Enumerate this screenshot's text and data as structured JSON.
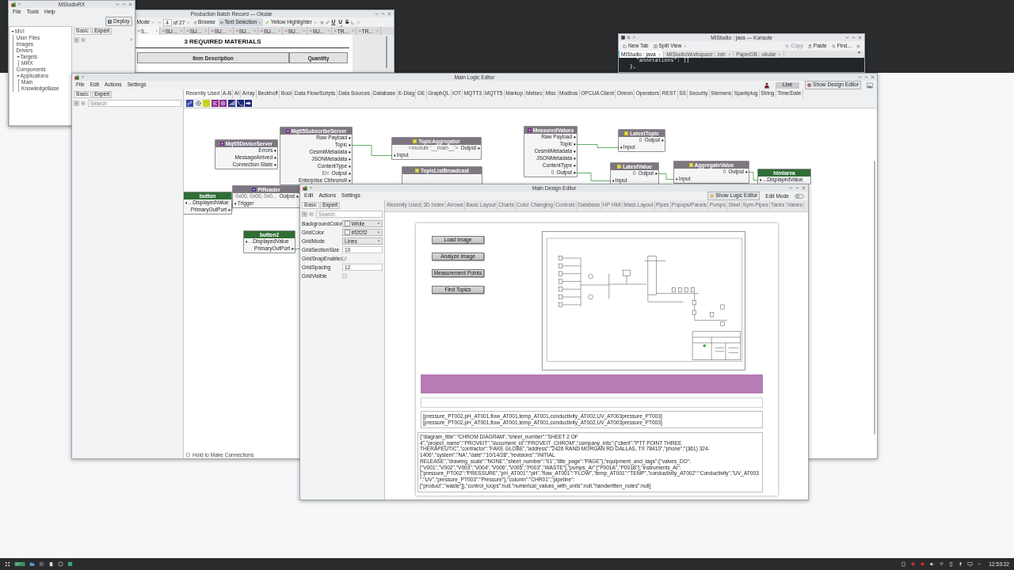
{
  "studio_window": {
    "title": "MStudioRX",
    "menu": [
      "File",
      "Tools",
      "Help"
    ],
    "deploy_button": "Deploy",
    "tree": [
      {
        "label": "MVI",
        "expanded": true,
        "children": [
          {
            "label": "User Files"
          },
          {
            "label": "Images"
          },
          {
            "label": "Drivers"
          },
          {
            "label": "Targets",
            "expanded": true,
            "children": [
              {
                "label": "MRX"
              }
            ]
          },
          {
            "label": "Components"
          },
          {
            "label": "Applications",
            "expanded": true,
            "children": [
              {
                "label": "Main"
              },
              {
                "label": "KnowledgeBase"
              }
            ]
          }
        ]
      }
    ],
    "panel_tabs": [
      {
        "label": "Basic",
        "selected": true
      },
      {
        "label": "Expert",
        "selected": false
      }
    ]
  },
  "pdf_window": {
    "title": "Production Batch Record — Okular",
    "mode_select": "Mode",
    "page_field": "4",
    "page_count": "of 27",
    "tools": [
      {
        "label": "Browse",
        "selected": false
      },
      {
        "label": "Text Selection",
        "selected": true
      }
    ],
    "highlighter_select": "Yellow Highlighter",
    "format_buttons": [
      {
        "label": "U",
        "kind": "underline"
      },
      {
        "label": "U",
        "kind": "squiggle"
      },
      {
        "label": "S",
        "kind": "strike"
      }
    ],
    "doc_tabs": [
      {
        "label": "S...",
        "selected": true
      },
      {
        "label": "SU...",
        "selected": false
      },
      {
        "label": "SU...",
        "selected": false
      },
      {
        "label": "SU...",
        "selected": false
      },
      {
        "label": "SU...",
        "selected": false
      },
      {
        "label": "SU...",
        "selected": false
      },
      {
        "label": "SU...",
        "selected": false
      },
      {
        "label": "SU...",
        "selected": false
      },
      {
        "label": "TR...",
        "selected": false
      },
      {
        "label": "TR...",
        "selected": false
      }
    ],
    "heading": "3 REQUIRED MATERIALS",
    "table_columns": [
      "Item Description",
      "Quantity"
    ]
  },
  "console_window": {
    "title": "MIStudio : java — Konsole",
    "toolbar_left": [
      {
        "label": "New Tab",
        "kind": "new-tab"
      },
      {
        "label": "Split View",
        "kind": "split"
      }
    ],
    "toolbar_right": [
      {
        "label": "Copy",
        "kind": "copy",
        "disabled": true
      },
      {
        "label": "Paste",
        "kind": "paste",
        "disabled": false
      },
      {
        "label": "Find...",
        "kind": "find",
        "disabled": false
      }
    ],
    "tabs": [
      {
        "label": "MIStudio : java",
        "selected": true
      },
      {
        "label": "MIStudioWorkspace : zsh",
        "selected": false
      },
      {
        "label": "PaperDB : okular",
        "selected": false
      }
    ],
    "lines": [
      "    \"annotations\": []",
      "  },"
    ]
  },
  "logic_window": {
    "title": "Main Logic Editor",
    "menu": [
      "File",
      "Edit",
      "Actions",
      "Settings"
    ],
    "live_button": "Live",
    "design_button": "Show Design Editor",
    "panel_tabs": [
      {
        "label": "Basic",
        "selected": true
      },
      {
        "label": "Expert",
        "selected": false
      }
    ],
    "search_placeholder": "Search",
    "palette_tabs": [
      {
        "label": "Recently Used",
        "selected": true
      },
      {
        "label": "A-B",
        "selected": false
      },
      {
        "label": "AI",
        "selected": false
      },
      {
        "label": "Array",
        "selected": false
      },
      {
        "label": "Beckhoff",
        "selected": false
      },
      {
        "label": "Bool",
        "selected": false
      },
      {
        "label": "Data Flow/Scripts",
        "selected": false
      },
      {
        "label": "Data Sources",
        "selected": false
      },
      {
        "label": "Database",
        "selected": false
      },
      {
        "label": "E-Diag",
        "selected": false
      },
      {
        "label": "GE",
        "selected": false
      },
      {
        "label": "GraphQL",
        "selected": false
      },
      {
        "label": "IOT",
        "selected": false
      },
      {
        "label": "MQTT3",
        "selected": false
      },
      {
        "label": "MQTT5",
        "selected": false
      },
      {
        "label": "Markup",
        "selected": false
      },
      {
        "label": "Melsec",
        "selected": false
      },
      {
        "label": "Misc",
        "selected": false
      },
      {
        "label": "Modbus",
        "selected": false
      },
      {
        "label": "OPCUA Client",
        "selected": false
      },
      {
        "label": "Omron",
        "selected": false
      },
      {
        "label": "Operators",
        "selected": false
      },
      {
        "label": "REST",
        "selected": false
      },
      {
        "label": "SS",
        "selected": false
      },
      {
        "label": "Security",
        "selected": false
      },
      {
        "label": "Siemens",
        "selected": false
      },
      {
        "label": "Sparkplug",
        "selected": false
      },
      {
        "label": "String",
        "selected": false
      },
      {
        "label": "Time/Date",
        "selected": false
      }
    ],
    "nodes": [
      {
        "title": "Mqtt5DeviceServer",
        "kind": "logic",
        "ports": [
          {
            "label": "Errors",
            "kind": "output"
          },
          {
            "label": "MessageArrived",
            "kind": "output"
          },
          {
            "label": "Connection State",
            "kind": "output"
          }
        ]
      },
      {
        "title": "Mqtt5SubscribeServer",
        "kind": "logic",
        "ports": [
          {
            "label": "Raw Payload",
            "kind": "output"
          },
          {
            "label": "Topic",
            "kind": "output"
          },
          {
            "label": "CesmiiMetadata",
            "kind": "output"
          },
          {
            "label": "JSONMetadata",
            "kind": "output"
          },
          {
            "label": "ContentType",
            "kind": "output"
          },
          {
            "preview": "Err",
            "label": "Output",
            "kind": "output"
          },
          {
            "label": "Enterprise Ctrhrom/#",
            "kind": "output"
          }
        ]
      },
      {
        "title": "TopicAggregator",
        "kind": "logic",
        "ports": [
          {
            "preview": "<module '__main__'>",
            "label": "Output",
            "kind": "output"
          },
          {
            "label": "Input",
            "kind": "input"
          }
        ]
      },
      {
        "title": "TopicListBroadcast",
        "kind": "logic"
      },
      {
        "title": "MeasuredValues",
        "kind": "logic",
        "ports": [
          {
            "label": "Raw Payload",
            "kind": "output"
          },
          {
            "label": "Topic",
            "kind": "output"
          },
          {
            "label": "CesmiiMetadata",
            "kind": "output"
          },
          {
            "label": "JSONMetadata",
            "kind": "output"
          },
          {
            "label": "ContentType",
            "kind": "output"
          },
          {
            "preview": "0",
            "label": "Output",
            "kind": "output"
          }
        ]
      },
      {
        "title": "LatestTopic",
        "kind": "logic",
        "ports": [
          {
            "preview": "0",
            "label": "Output",
            "kind": "output"
          },
          {
            "label": "Input",
            "kind": "input"
          }
        ]
      },
      {
        "title": "LatestValue",
        "kind": "logic",
        "ports": [
          {
            "preview": "0",
            "label": "Output",
            "kind": "output"
          },
          {
            "label": "Input",
            "kind": "input"
          }
        ]
      },
      {
        "title": "AggregateValue",
        "kind": "logic",
        "ports": [
          {
            "preview": "0",
            "label": "Output",
            "kind": "output"
          },
          {
            "label": "Input",
            "kind": "input"
          }
        ]
      },
      {
        "title": "htmlarea",
        "kind": "widget",
        "ports": [
          {
            "label": "...DisplayedValue",
            "kind": "input"
          }
        ]
      },
      {
        "title": "button",
        "kind": "widget",
        "ports": [
          {
            "label": "...DisplayedValue",
            "kind": "input"
          },
          {
            "label": "PrimaryOutPort",
            "kind": "output"
          }
        ]
      },
      {
        "title": "PIReader",
        "kind": "logic",
        "ports": [
          {
            "preview": "0x00, 0x00, 0x0...",
            "label": "Output",
            "kind": "output"
          },
          {
            "label": "Trigger",
            "kind": "input"
          }
        ]
      },
      {
        "title": "button2",
        "kind": "widget",
        "ports": [
          {
            "label": "...DisplayedValue",
            "kind": "input"
          },
          {
            "label": "PrimaryOutPort",
            "kind": "output"
          }
        ]
      }
    ],
    "status_text": "Hold to Make Connections"
  },
  "design_window": {
    "title": "Main Design Editor",
    "menu": [
      "Edit",
      "Actions",
      "Settings"
    ],
    "logic_button": "Show Logic Editor",
    "edit_mode": {
      "label": "Edit Mode",
      "on": false
    },
    "panel_tabs": [
      {
        "label": "Basic",
        "selected": true
      },
      {
        "label": "Expert",
        "selected": false
      }
    ],
    "search_placeholder": "Search",
    "properties": [
      {
        "name": "BackgroundColor",
        "kind": "color",
        "value": "White"
      },
      {
        "name": "GridColor",
        "kind": "color",
        "value": "#f2f2f2"
      },
      {
        "name": "GridMode",
        "kind": "dropdown",
        "value": "Lines"
      },
      {
        "name": "GridSectionSize",
        "kind": "number",
        "value": "10"
      },
      {
        "name": "GridSnapEnabled",
        "kind": "checkbox",
        "checked": true
      },
      {
        "name": "GridSpacing",
        "kind": "number",
        "value": "12"
      },
      {
        "name": "GridVisible",
        "kind": "checkbox",
        "checked": false
      }
    ],
    "palette_tabs": [
      {
        "label": "Recently Used",
        "disabled": true
      },
      {
        "label": "3D Index",
        "disabled": true
      },
      {
        "label": "Arrows",
        "disabled": true
      },
      {
        "label": "Basic Layout",
        "disabled": true
      },
      {
        "label": "Charts",
        "disabled": true
      },
      {
        "label": "Color Changing",
        "disabled": true
      },
      {
        "label": "Controls",
        "disabled": true
      },
      {
        "label": "Database",
        "disabled": true
      },
      {
        "label": "HP HMI",
        "disabled": true
      },
      {
        "label": "Mass Layout",
        "disabled": true
      },
      {
        "label": "Pipes",
        "disabled": true
      },
      {
        "label": "Popups/Panels",
        "disabled": true
      },
      {
        "label": "Pumps",
        "disabled": true
      },
      {
        "label": "Steel",
        "disabled": true
      },
      {
        "label": "Sym-Pipes",
        "disabled": true
      },
      {
        "label": "Tanks",
        "disabled": true
      },
      {
        "label": "Valves",
        "disabled": true
      }
    ],
    "canvas_buttons": [
      "Load Image",
      "Analyze Image",
      "Measurement Points",
      "Find Topics"
    ],
    "tag_list_lines": [
      "[pressure_PT002,pH_AT001,flow_AT001,temp_AT001,conductivity_AT002,UV_AT003pressure_PT003]",
      "[pressure_PT002,pH_AT001,flow_AT001,temp_AT001,conductivity_AT002,UV_AT003pressure_PT003]"
    ],
    "json_text": "{\"diagram_title\":\"CHROM DIAGRAM\",\"sheet_number\":\"SHEET 2 OF 4\",\"project_name\":\"PROVEIT\",\"document_id\":\"PROVEIT_CHROM\",\"company_info\":{\"client\":\"PTT POINT THREE THERAPEUTIC\",\"contractor\":\"FAKE GLOBE\",\"address\":\"2426 RAND MORGAN RD DALLAS, TX 78410\",\"phone\":\"(361) 324-1406\",\"system\":\"NA\",\"date\":\"10/14/28\",\"revisions\":\"INITIAL RELEASE\",\"drawing_scale\":\"NONE\",\"sheet_number\":\"01\",\"title_page\":\"PAGE\"},\"equipment_and_tags\":{\"valves_DO\":[\"V001\",\"V002\",\"V003\",\"V004\",\"V006\",\"V005\",\"P003\",\"WASTE\"],\"pumps_AI\":[\"P001A\",\"P001B\"],\"instruments_AI\":{\"pressure_PT002\":\"PRESSURE\",\"pH_AT001\":\"pH\",\"flow_AT001\":\"FLOW\",\"temp_AT001\":\"TEMP\",\"conductivity_AT002\":\"Conductivity\",\"UV_AT003\":\"UV\",\"pressure_PT003\":\"Pressure\"},\"column\":\"CHR01\",\"pipeline\":[\"product\",\"waste\"]},\"control_loops\":null,\"numerical_values_with_units\":null,\"handwritten_notes\":null}"
  },
  "taskbar": {
    "clock": "12:53:22"
  }
}
